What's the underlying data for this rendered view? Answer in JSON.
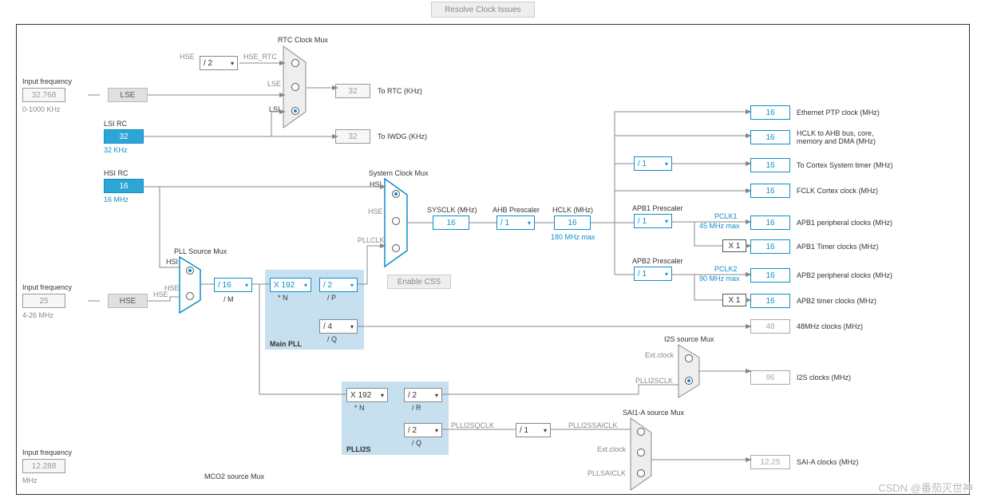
{
  "toolbar": {
    "resolve": "Resolve Clock Issues"
  },
  "inputs": {
    "freq1": {
      "label": "Input frequency",
      "value": "32.768",
      "range": "0-1000 KHz"
    },
    "freq2": {
      "label": "Input frequency",
      "value": "25",
      "range": "4-26 MHz"
    },
    "freq3": {
      "label": "Input frequency",
      "value": "12.288",
      "range": "MHz"
    }
  },
  "sources": {
    "lse": "LSE",
    "hse": "HSE",
    "lsi_rc": "LSI RC",
    "lsi_val": "32",
    "lsi_note": "32 KHz",
    "hsi_rc": "HSI RC",
    "hsi_val": "16",
    "hsi_note": "16 MHz",
    "hse_pin": "HSE"
  },
  "rtc": {
    "mux_title": "RTC Clock Mux",
    "hse_label": "HSE",
    "hse_div": "/ 2",
    "hse_rtc": "HSE_RTC",
    "lse": "LSE",
    "lsi": "LSI",
    "rtc_val": "32",
    "rtc_label": "To RTC (KHz)",
    "iwdg_val": "32",
    "iwdg_label": "To IWDG (KHz)"
  },
  "sysmux": {
    "title": "System Clock Mux",
    "hsi": "HSI",
    "hse": "HSE",
    "pllclk": "PLLCLK",
    "enable_css": "Enable CSS",
    "sysclk_label": "SYSCLK (MHz)",
    "sysclk_val": "16",
    "ahb_label": "AHB Prescaler",
    "ahb_div": "/ 1",
    "hclk_label": "HCLK (MHz)",
    "hclk_val": "16",
    "hclk_note": "180 MHz max"
  },
  "pll": {
    "src_title": "PLL Source Mux",
    "hsi": "HSI",
    "hse": "HSE",
    "div_m": "/ 16",
    "div_m_lbl": "/ M",
    "mul_n": "X 192",
    "mul_n_lbl": "* N",
    "div_p": "/ 2",
    "div_p_lbl": "/ P",
    "div_q": "/ 4",
    "div_q_lbl": "/ Q",
    "main_lbl": "Main PLL",
    "i2s_mul": "X 192",
    "i2s_mul_lbl": "* N",
    "i2s_r": "/ 2",
    "i2s_r_lbl": "/ R",
    "i2s_q": "/ 2",
    "i2s_q_lbl": "/ Q",
    "i2s_box": "PLLI2S"
  },
  "apb": {
    "cortex_div": "/ 1",
    "apb1_title": "APB1 Prescaler",
    "apb1_div": "/ 1",
    "apb1_pclk": "PCLK1",
    "apb1_note": "45 MHz max",
    "apb1_mul": "X 1",
    "apb2_title": "APB2 Prescaler",
    "apb2_div": "/ 1",
    "apb2_pclk": "PCLK2",
    "apb2_note": "90 MHz max",
    "apb2_mul": "X 1"
  },
  "i2s": {
    "mux_title": "I2S source Mux",
    "ext": "Ext.clock",
    "plli2sclk": "PLLI2SCLK"
  },
  "sai": {
    "mux_title": "SAI1-A source Mux",
    "plli2ssaiclk": "PLLI2SSAICLK",
    "plli2sqclk": "PLLI2SQCLK",
    "div": "/ 1",
    "ext": "Ext.clock",
    "pllsaiclk": "PLLSAICLK"
  },
  "mco": {
    "title": "MCO2 source Mux"
  },
  "outputs": {
    "eth": {
      "v": "16",
      "l": "Ethernet PTP clock (MHz)"
    },
    "hclk_bus": {
      "v": "16",
      "l": "HCLK to AHB bus, core, memory and DMA (MHz)"
    },
    "cortex_sys": {
      "v": "16",
      "l": "To Cortex System timer (MHz)"
    },
    "fclk": {
      "v": "16",
      "l": "FCLK Cortex clock (MHz)"
    },
    "apb1_periph": {
      "v": "16",
      "l": "APB1 peripheral clocks (MHz)"
    },
    "apb1_timer": {
      "v": "16",
      "l": "APB1 Timer clocks (MHz)"
    },
    "apb2_periph": {
      "v": "16",
      "l": "APB2 peripheral clocks (MHz)"
    },
    "apb2_timer": {
      "v": "16",
      "l": "APB2 timer clocks (MHz)"
    },
    "clk48": {
      "v": "48",
      "l": "48MHz clocks (MHz)"
    },
    "i2s": {
      "v": "96",
      "l": "I2S clocks (MHz)"
    },
    "saia": {
      "v": "12.25",
      "l": "SAI-A clocks (MHz)"
    }
  },
  "watermark": "CSDN @番茄灭世神"
}
